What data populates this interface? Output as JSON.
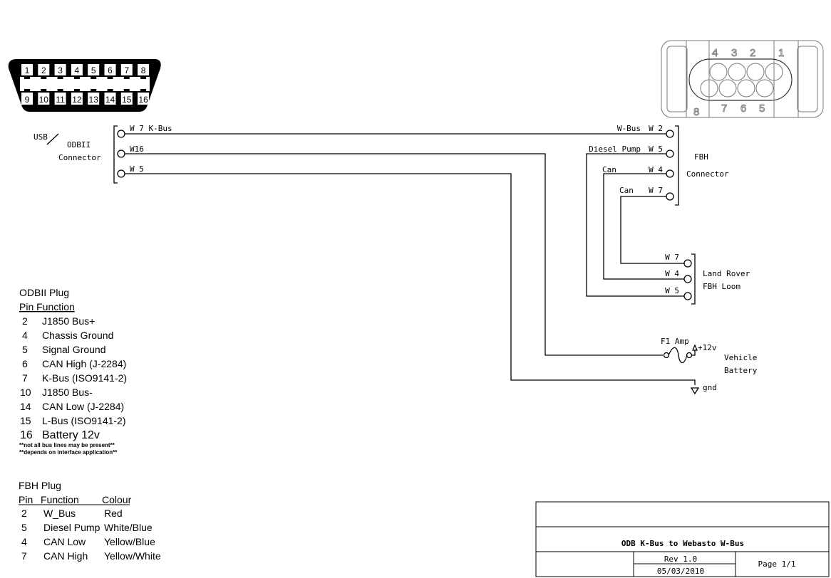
{
  "obd_connector": {
    "top_pins": [
      "1",
      "2",
      "3",
      "4",
      "5",
      "6",
      "7",
      "8"
    ],
    "bottom_pins": [
      "9",
      "10",
      "11",
      "12",
      "13",
      "14",
      "15",
      "16"
    ],
    "label_usb": "USB",
    "label_line1": "ODBII",
    "label_line2": "Connector",
    "terminals": [
      "W 7 K-Bus",
      "W16",
      "W 5"
    ]
  },
  "fbh_connector": {
    "top_numbers": [
      "4",
      "3",
      "2",
      "1"
    ],
    "bottom_numbers": [
      "8",
      "7",
      "6",
      "5"
    ],
    "label_line1": "FBH",
    "label_line2": "Connector",
    "terminals": [
      {
        "name": "W-Bus",
        "pin": "W 2"
      },
      {
        "name": "Diesel Pump",
        "pin": "W 5"
      },
      {
        "name": "Can",
        "pin": "W 4"
      },
      {
        "name": "Can",
        "pin": "W 7"
      }
    ]
  },
  "loom": {
    "label_line1": "Land Rover",
    "label_line2": "FBH Loom",
    "terminals": [
      "W 7",
      "W 4",
      "W 5"
    ]
  },
  "battery": {
    "fuse_label": "F1 Amp",
    "positive_label": "+12v",
    "ground_label": "gnd",
    "label_line1": "Vehicle",
    "label_line2": "Battery"
  },
  "odbii_table": {
    "title": "ODBII Plug",
    "header": "Pin  Function",
    "rows": [
      {
        "pin": "2",
        "function": "J1850 Bus+"
      },
      {
        "pin": "4",
        "function": "Chassis Ground"
      },
      {
        "pin": "5",
        "function": "Signal Ground"
      },
      {
        "pin": "6",
        "function": "CAN High (J-2284)"
      },
      {
        "pin": "7",
        "function": "K-Bus (ISO9141-2)"
      },
      {
        "pin": "10",
        "function": "J1850 Bus-"
      },
      {
        "pin": "14",
        "function": "CAN Low (J-2284)"
      },
      {
        "pin": "15",
        "function": "L-Bus (ISO9141-2)"
      },
      {
        "pin": "16",
        "function": "Battery 12v"
      }
    ],
    "note1": "**not all bus lines  may be present**",
    "note2": "**depends on interface application**"
  },
  "fbh_table": {
    "title": "FBH Plug",
    "headers": [
      "Pin",
      "Function",
      "Colour"
    ],
    "rows": [
      {
        "pin": "2",
        "function": "W_Bus",
        "colour": "Red"
      },
      {
        "pin": "5",
        "function": "Diesel Pump",
        "colour": "White/Blue"
      },
      {
        "pin": "4",
        "function": "CAN Low",
        "colour": "Yellow/Blue"
      },
      {
        "pin": "7",
        "function": "CAN High",
        "colour": "Yellow/White"
      }
    ]
  },
  "title_block": {
    "title": "ODB K-Bus to Webasto W-Bus",
    "rev": "Rev 1.0",
    "date": "05/03/2010",
    "page": "Page 1/1"
  }
}
